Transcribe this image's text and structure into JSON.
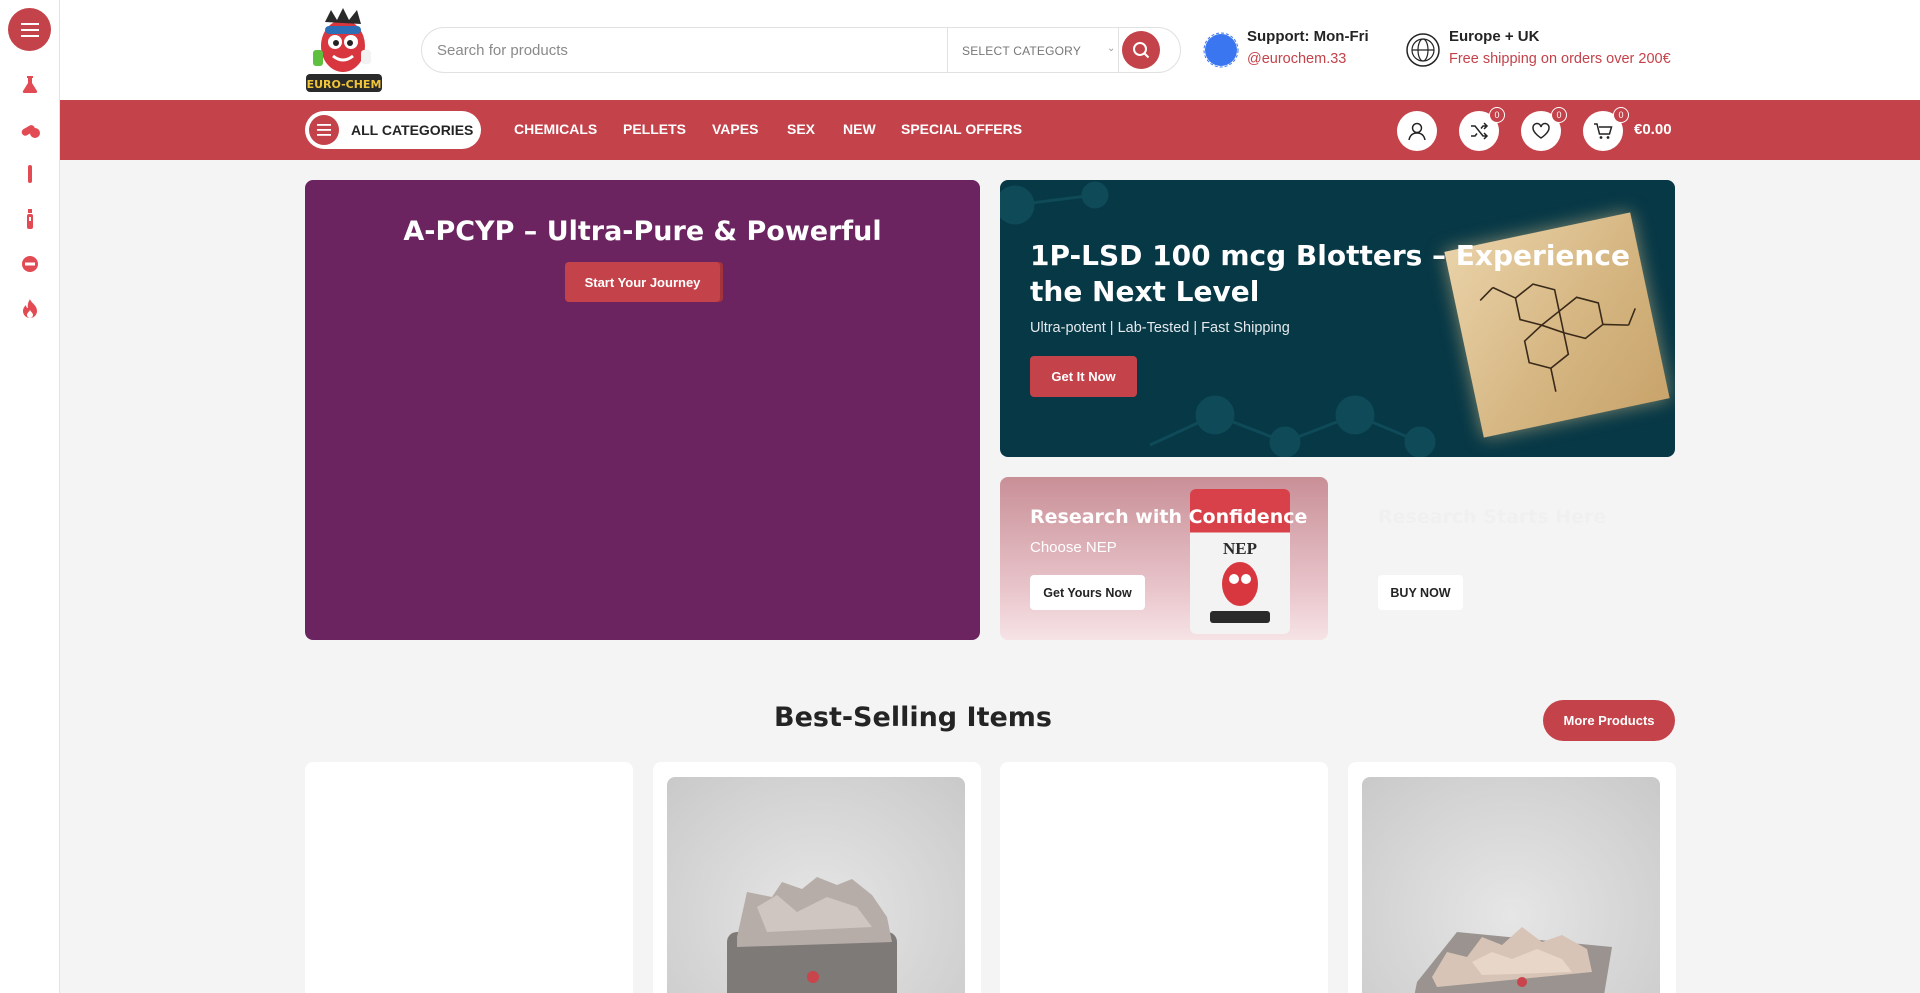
{
  "sidebar": {
    "items": [
      {
        "icon": "menu-icon"
      },
      {
        "icon": "flask-icon"
      },
      {
        "icon": "pills-icon"
      },
      {
        "icon": "test-tube-icon"
      },
      {
        "icon": "vape-icon"
      },
      {
        "icon": "no-entry-icon"
      },
      {
        "icon": "fire-icon"
      }
    ]
  },
  "header": {
    "search": {
      "placeholder": "Search for products",
      "category": "SELECT CATEGORY"
    },
    "support": {
      "title": "Support: Mon-Fri",
      "handle": "@eurochem.33"
    },
    "region": {
      "title": "Europe + UK",
      "shipping": "Free shipping on orders over 200€"
    }
  },
  "nav": {
    "all_categories": "ALL CATEGORIES",
    "links": [
      "CHEMICALS",
      "PELLETS",
      "VAPES",
      "SEX",
      "NEW",
      "SPECIAL OFFERS"
    ],
    "compare_count": "0",
    "wishlist_count": "0",
    "cart_count": "0",
    "cart_total": "€0.00"
  },
  "banners": {
    "main": {
      "title": " A-PCYP – Ultra-Pure & Powerful",
      "button": "Start Your Journey"
    },
    "lsd": {
      "title": "1P-LSD 100 mcg Blotters – Experience the Next Level",
      "subtitle": "Ultra-potent | Lab-Tested | Fast Shipping",
      "button": "Get It Now"
    },
    "nep": {
      "title": "Research with Confidence",
      "subtitle": "Choose NEP",
      "button": "Get Yours Now",
      "bag_label": "NEP"
    },
    "research": {
      "title": "Research Starts Here",
      "subtitle": "",
      "button": "BUY NOW"
    }
  },
  "best_selling": {
    "title": "Best-Selling Items",
    "more_button": "More Products"
  },
  "colors": {
    "brand_red": "#c4424a",
    "purple": "#6b2460",
    "teal": "#073846"
  }
}
